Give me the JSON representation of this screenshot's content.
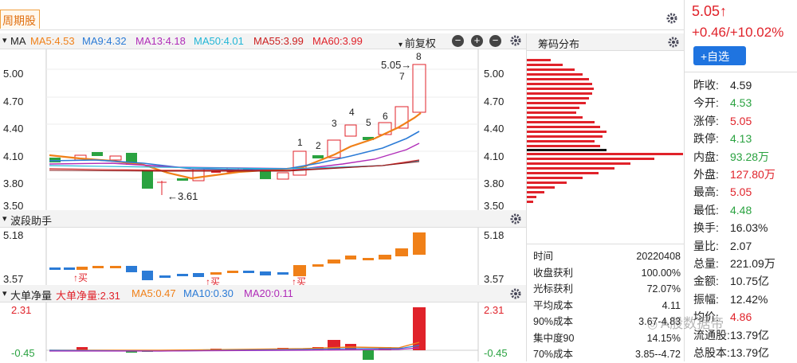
{
  "tab": {
    "label": "周期股"
  },
  "main_chart": {
    "ma_title": "MA",
    "ma5": "MA5:4.53",
    "ma9": "MA9:4.32",
    "ma13": "MA13:4.18",
    "ma50": "MA50:4.01",
    "ma55": "MA55:3.99",
    "ma60": "MA60:3.99",
    "adjust": "前复权",
    "y_ticks": [
      "5.00",
      "4.70",
      "4.40",
      "4.10",
      "3.80",
      "3.50"
    ],
    "low_annotation": "←3.61",
    "high_annotation": "5.05→",
    "day_counts": [
      "1",
      "2",
      "3",
      "4",
      "5",
      "6",
      "7",
      "8"
    ]
  },
  "wave_panel": {
    "title": "波段助手",
    "top": "5.18",
    "bottom": "3.57",
    "buy_label": "↑买"
  },
  "flow_panel": {
    "title": "大单净量",
    "value": "大单净量:2.31",
    "ma5": "MA5:0.47",
    "ma10": "MA10:0.30",
    "ma20": "MA20:0.11",
    "top": "2.31",
    "bottom": "-0.45"
  },
  "chips": {
    "title": "筹码分布",
    "rows": [
      {
        "k": "时间",
        "v": "20220408"
      },
      {
        "k": "收盘获利",
        "v": "100.00%"
      },
      {
        "k": "光标获利",
        "v": "72.07%"
      },
      {
        "k": "平均成本",
        "v": "4.11"
      },
      {
        "k": "90%成本",
        "v": "3.67-4.83"
      },
      {
        "k": "集中度90",
        "v": "14.15%"
      },
      {
        "k": "70%成本",
        "v": "3.85--4.72"
      }
    ]
  },
  "quote": {
    "price": "5.05↑",
    "change": "+0.46/+10.02%",
    "watch_btn": "+自选",
    "rows": [
      {
        "k": "昨收:",
        "v": "4.59",
        "c": "#222222"
      },
      {
        "k": "今开:",
        "v": "4.53",
        "c": "#2aa240"
      },
      {
        "k": "涨停:",
        "v": "5.05",
        "c": "#e0222a"
      },
      {
        "k": "跌停:",
        "v": "4.13",
        "c": "#2aa240"
      },
      {
        "k": "内盘:",
        "v": "93.28万",
        "c": "#2aa240"
      },
      {
        "k": "外盘:",
        "v": "127.80万",
        "c": "#e0222a"
      },
      {
        "k": "最高:",
        "v": "5.05",
        "c": "#e0222a"
      },
      {
        "k": "最低:",
        "v": "4.48",
        "c": "#2aa240"
      },
      {
        "k": "换手:",
        "v": "16.03%",
        "c": "#222222"
      },
      {
        "k": "量比:",
        "v": "2.07",
        "c": "#222222"
      },
      {
        "k": "总量:",
        "v": "221.09万",
        "c": "#222222"
      },
      {
        "k": "金额:",
        "v": "10.75亿",
        "c": "#222222"
      },
      {
        "k": "振幅:",
        "v": "12.42%",
        "c": "#222222"
      },
      {
        "k": "均价:",
        "v": "4.86",
        "c": "#e0222a"
      },
      {
        "k": "流通股:",
        "v": "13.79亿",
        "c": "#222222"
      },
      {
        "k": "总股本:",
        "v": "13.79亿",
        "c": "#222222"
      }
    ]
  },
  "watermark": "A股数据帝",
  "colors": {
    "up": "#e0222a",
    "down": "#2aa240",
    "ma5": "#f08018",
    "ma9": "#2b7bd6",
    "ma13": "#b02cb8"
  }
}
